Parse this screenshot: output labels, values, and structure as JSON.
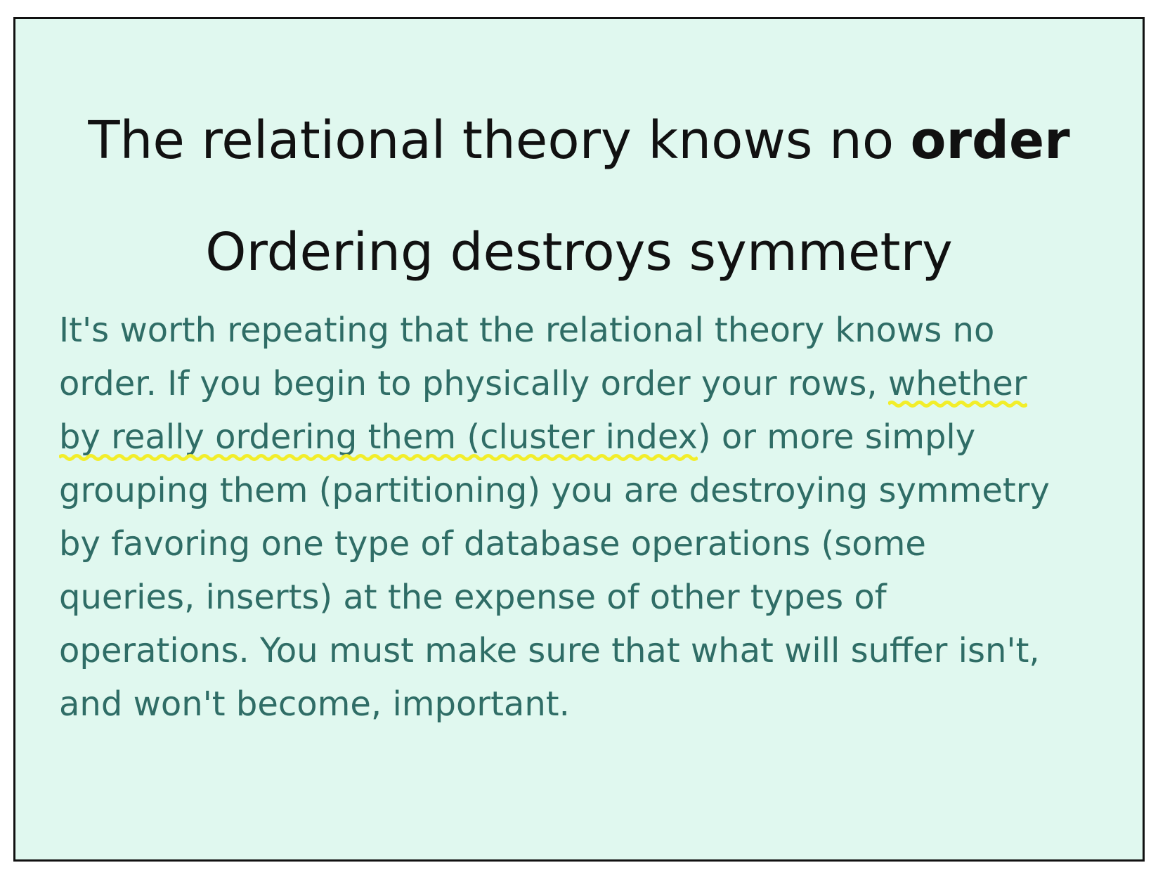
{
  "slide": {
    "title_line1_prefix": "The relational theory knows no ",
    "title_line1_bold": "order",
    "title_line2": "Ordering destroys symmetry",
    "paragraph": {
      "line1": "It's worth repeating that the relational theory knows no",
      "line2_prefix": "order. If you begin to physically order your rows, ",
      "line2_highlight": "whether",
      "line3_highlight": "by really ordering them (cluster index",
      "line3_suffix": ") or more simply",
      "line4": "grouping them (partitioning) you are destroying symmetry",
      "line5": "by favoring one type of database operations (some",
      "line6": "queries, inserts) at the expense of other types of",
      "line7": "operations. You must make sure that what will suffer isn't,",
      "line8": "and won't become, important."
    },
    "highlight_color": "#f2ee2a",
    "background_color": "#e0f8ef",
    "text_color": "#2f6d66"
  }
}
